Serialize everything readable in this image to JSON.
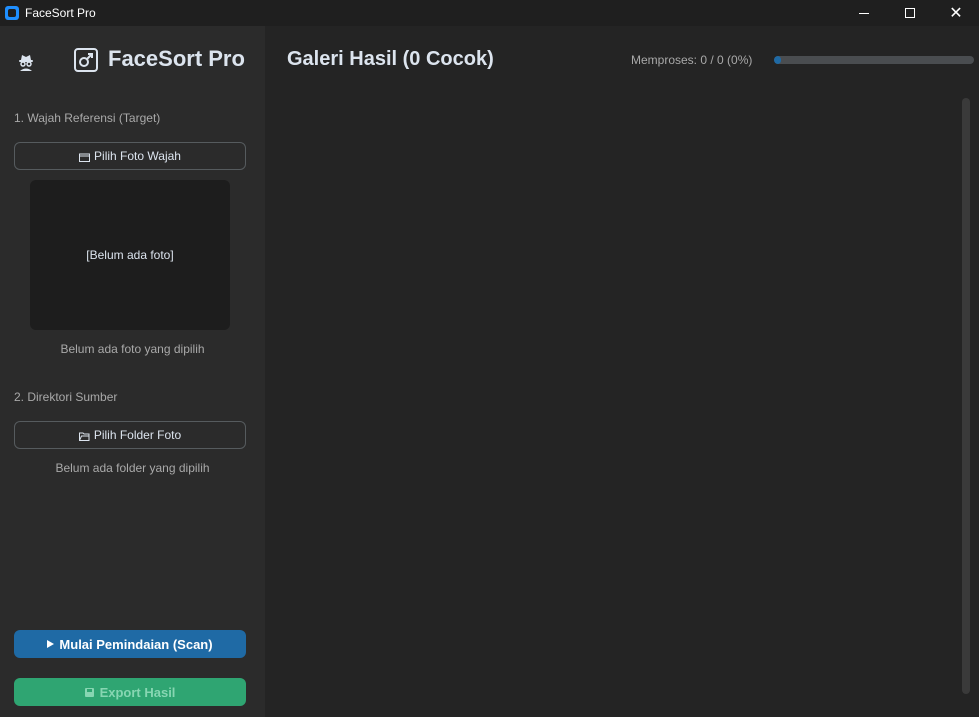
{
  "window": {
    "title": "FaceSort Pro",
    "controls": {
      "minimize": "minimize",
      "maximize": "maximize",
      "close": "✕"
    }
  },
  "sidebar": {
    "app_title": "FaceSort Pro",
    "reference": {
      "label": "1. Wajah Referensi (Target)",
      "button_label": "Pilih Foto Wajah",
      "preview_text": "[Belum ada foto]",
      "status": "Belum ada foto yang dipilih"
    },
    "source": {
      "label": "2. Direktori Sumber",
      "button_label": "Pilih Folder Foto",
      "status": "Belum ada folder yang dipilih"
    },
    "scan_button": "Mulai Pemindaian (Scan)",
    "export_button": "Export Hasil"
  },
  "main": {
    "title": "Galeri Hasil (0 Cocok)",
    "progress": {
      "label": "Memproses: 0 / 0 (0%)",
      "value": 0
    }
  },
  "colors": {
    "accent": "#1f6aa5",
    "success": "#2fa572",
    "sidebar_bg": "#2b2b2b",
    "main_bg": "#242424"
  },
  "icons": {
    "spy": "spy-icon",
    "logo": "male-sign-icon",
    "photo_button": "calendar-icon",
    "folder_button": "folder-open-icon",
    "scan": "play-icon",
    "export": "save-icon"
  }
}
